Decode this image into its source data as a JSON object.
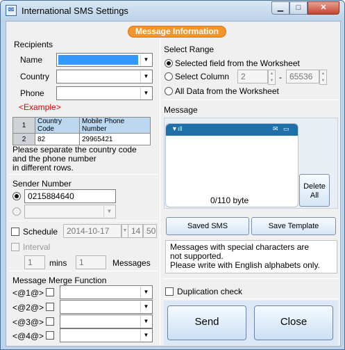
{
  "window": {
    "title": "International SMS Settings",
    "controls": [
      "minimize",
      "maximize",
      "close"
    ]
  },
  "header": {
    "label": "Message Information"
  },
  "recipients": {
    "section_label": "Recipients",
    "name_label": "Name",
    "country_label": "Country",
    "phone_label": "Phone",
    "example_label": "<Example>",
    "example_table": {
      "rows": [
        [
          "1",
          "Country Code",
          "Mobile Phone Number"
        ],
        [
          "2",
          "82",
          "29965421"
        ]
      ]
    },
    "help_line1": "Please separate the country code",
    "help_line2": "and the phone number",
    "help_line3": "in different rows."
  },
  "sender": {
    "section_label": "Sender Number",
    "number_value": "0215884640"
  },
  "schedule": {
    "label": "Schedule",
    "date": "2014-10-17",
    "hour": "14",
    "minute": "50"
  },
  "interval": {
    "label": "Interval",
    "mins_value": "1",
    "mins_label": "mins",
    "messages_value": "1",
    "messages_label": "Messages"
  },
  "merge": {
    "section_label": "Message Merge Function",
    "fields": [
      "<@1@>",
      "<@2@>",
      "<@3@>",
      "<@4@>"
    ]
  },
  "range": {
    "section_label": "Select Range",
    "option_selected_field": "Selected field from the Worksheet",
    "option_select_column": "Select Column",
    "column_from": "2",
    "column_to": "65536",
    "separator": "-",
    "option_all_data": "All Data from the Worksheet"
  },
  "message": {
    "section_label": "Message",
    "counter": "0/110",
    "unit": "byte",
    "delete_all_line1": "Delete",
    "delete_all_line2": "All"
  },
  "buttons": {
    "saved_sms": "Saved SMS",
    "save_template": "Save Template",
    "send": "Send",
    "close": "Close"
  },
  "warning": {
    "line1": "Messages with special characters are",
    "line2": "not supported.",
    "line3": "Please write with English alphabets only."
  },
  "duplication": {
    "label": "Duplication check"
  },
  "colors": {
    "accent": "#f39629",
    "title_bar": "#bcd3ea",
    "selection": "#3399ff",
    "example_red": "#e00000",
    "phone_bar": "#1f6fa8"
  }
}
